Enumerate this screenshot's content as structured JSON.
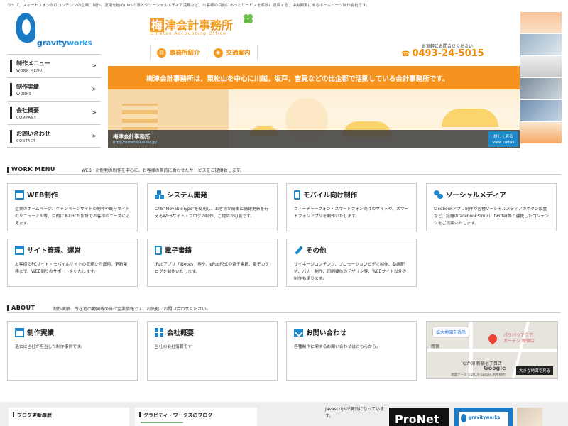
{
  "top_description": "ウェブ、スマートフォン向けコンテンツの企画、制作。運用を始めCMSの導入やソーシャルメディア活用など、お客様の目的にあったサービスを柔軟に提供する、中央関東にあるホームページ制作会社です。",
  "logo": {
    "word_a": "gravity",
    "word_b": "works"
  },
  "nav": [
    {
      "jp": "制作メニュー",
      "en": "WORK MENU"
    },
    {
      "jp": "制作実績",
      "en": "WORKS"
    },
    {
      "jp": "会社概要",
      "en": "COMPANY"
    },
    {
      "jp": "お問い合わせ",
      "en": "CONTACT"
    }
  ],
  "nav_arrow": ">",
  "header": {
    "brand_first": "梅",
    "brand_rest": "津会計事務所",
    "brand_en": "Umetsu Accounting Office",
    "tabs": [
      {
        "label": "事務所紹介",
        "icon": "building-icon",
        "glyph": "▤"
      },
      {
        "label": "交通案内",
        "icon": "location-pin-icon",
        "glyph": "◉"
      }
    ],
    "contact_note": "お気軽にお問合せください",
    "phone_glyph": "☎",
    "phone": "0493-24-5015"
  },
  "banner": {
    "headline": "梅津会計事務所は，東松山を中心に川越，坂戸，吉見などの比企郡で活動している会計事務所です。",
    "caption_title": "梅津会計事務所",
    "caption_url": "http://umetsukaikei.jp/",
    "more_line1": "詳しく見る",
    "more_line2": "View Detail"
  },
  "work_menu": {
    "title": "WORK MENU",
    "description": "WEB・計制物の制作を中心に、お客様の目的に合わせたサービスをご提供致します。",
    "cards": [
      {
        "title": "WEB制作",
        "icon": "browser-window-icon",
        "body": "企業のホームページ、キャンペーンサイトの制作や既存サイトのリニューアル等、目的にあわせた設計でお客様のニーズに応えます。"
      },
      {
        "title": "システム開発",
        "icon": "cubes-icon",
        "body": "CMS\"MovableType\"を使用し、お客様が簡単に情報更新を行えるWEBサイト・ブログの制作、ご提供が可能です。"
      },
      {
        "title": "モバイル向け制作",
        "icon": "mobile-phone-icon",
        "body": "フィーチャーフォン・スマートフォン向けのサイトや、スマートフォンアプリを制作いたします。"
      },
      {
        "title": "ソーシャルメディア",
        "icon": "chat-bubbles-icon",
        "body": "facebookアプリ制作や各種ソーシャルメディアのボタン設置など、話題のfacebookやmixi、twitter等と連携したコンテンツをご提案いたします。"
      },
      {
        "title": "サイト管理、運営",
        "icon": "site-admin-icon",
        "body": "お客様のPCサイト・モバイルサイトの管理から運用、更新業務まで、WEB周りのサポートをいたします。"
      },
      {
        "title": "電子書籍",
        "icon": "tablet-icon",
        "body": "iPadアプリ「iBooks」用や、ePub形式の電子書籍、電子カタログを制作いたします。"
      },
      {
        "title": "その他",
        "icon": "pen-icon",
        "body": "サイネージコンテンツ、プロモーションビデオ制作、動画配信、バナー制作、印刷媒体のデザイン等、WEBサイト以外の制作も承ります。"
      }
    ]
  },
  "about": {
    "title": "ABOUT",
    "description": "制作実績、所在地の地図等の当社企業情報です。お気軽にお問い合わせください。",
    "cards": [
      {
        "title": "制作実績",
        "icon": "browser-window-icon",
        "body": "過去に当社が担当した制作事例です。"
      },
      {
        "title": "会社概要",
        "icon": "grid-icon",
        "body": "当社の会社情報です"
      },
      {
        "title": "お問い合わせ",
        "icon": "mail-icon",
        "body": "各種制作に関するお問い合わせはこちらから。"
      }
    ],
    "map": {
      "expand": "拡大地図を表示",
      "label1": "パウパウアクア",
      "label2": "ガーデン 新宿店",
      "label3": "なか卯 新宿七丁目店",
      "label4": "新宿",
      "google": "Google",
      "copyright": "地図データ ©2019 Google  利用規約",
      "view_large": "大きな地図で見る"
    }
  },
  "footer": {
    "blog_history": "ブログ更新履歴",
    "gw_blog": "グラビティ・ワークスのブログ",
    "js_note": "Javascriptが無効になっています。",
    "pronet": "ProNet",
    "gw_small": "gravityworks"
  },
  "colors": {
    "accent": "#f39a1e",
    "brand_blue": "#1c88c9",
    "banner_orange": "#f6921e"
  }
}
